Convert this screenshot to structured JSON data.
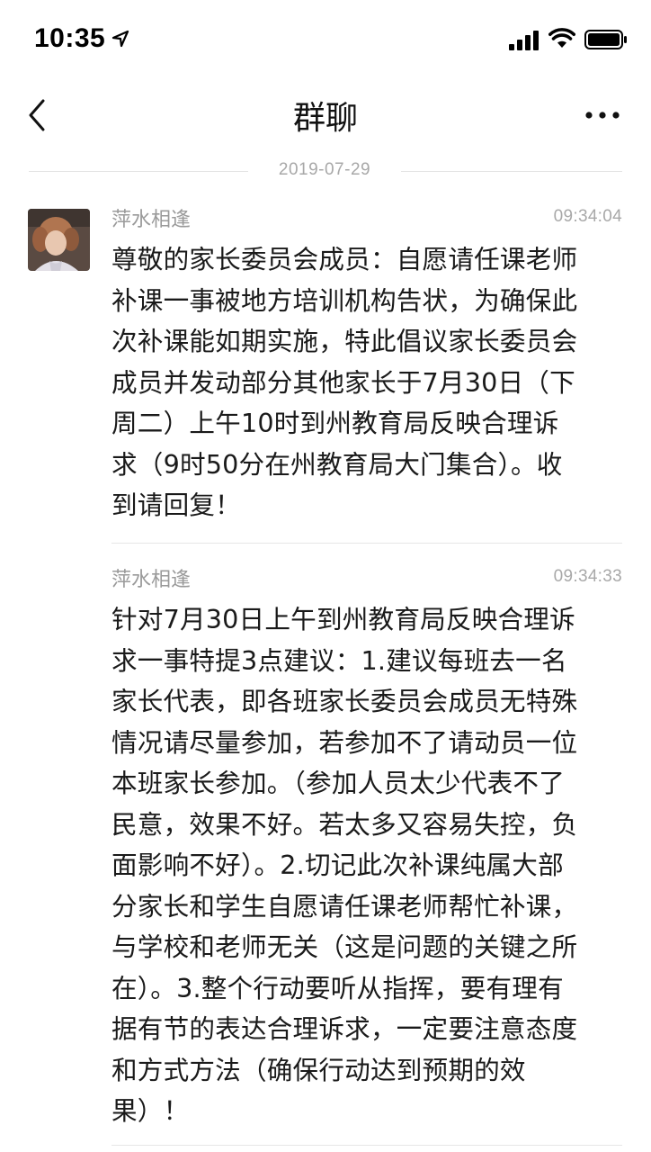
{
  "status_bar": {
    "time": "10:35",
    "icons": [
      "location-arrow-icon",
      "cellular-signal-icon",
      "wifi-icon",
      "battery-icon"
    ]
  },
  "nav": {
    "title": "群聊",
    "back_icon": "chevron-left-icon",
    "more_icon": "more-dots-icon"
  },
  "date_divider": "2019-07-29",
  "messages": [
    {
      "sender": "萍水相逢",
      "time": "09:34:04",
      "lines": [
        "尊敬的家长委员会成员：自愿请任课老师",
        "补课一事被地方培训机构告状，为确保此",
        "次补课能如期实施，特此倡议家长委员会",
        "成员并发动部分其他家长于7月30日（下",
        "周二）上午10时到州教育局反映合理诉",
        "求（9时50分在州教育局大门集合）。收",
        "到请回复！"
      ]
    },
    {
      "sender": "萍水相逢",
      "time": "09:34:33",
      "lines": [
        "针对7月30日上午到州教育局反映合理诉",
        "求一事特提3点建议：1.建议每班去一名",
        "家长代表，即各班家长委员会成员无特殊",
        "情况请尽量参加，若参加不了请动员一位",
        "本班家长参加。（参加人员太少代表不了",
        "民意，效果不好。若太多又容易失控，负",
        "面影响不好）。2.切记此次补课纯属大部",
        "分家长和学生自愿请任课老师帮忙补课，",
        "与学校和老师无关（这是问题的关键之所",
        "在）。3.整个行动要听从指挥，要有理有",
        "据有节的表达合理诉求，一定要注意态度",
        "和方式方法（确保行动达到预期的效",
        "果）！"
      ]
    }
  ],
  "colors": {
    "text_primary": "#1a1a1a",
    "text_secondary": "#9a9a9a",
    "divider": "#e6e6e6"
  }
}
